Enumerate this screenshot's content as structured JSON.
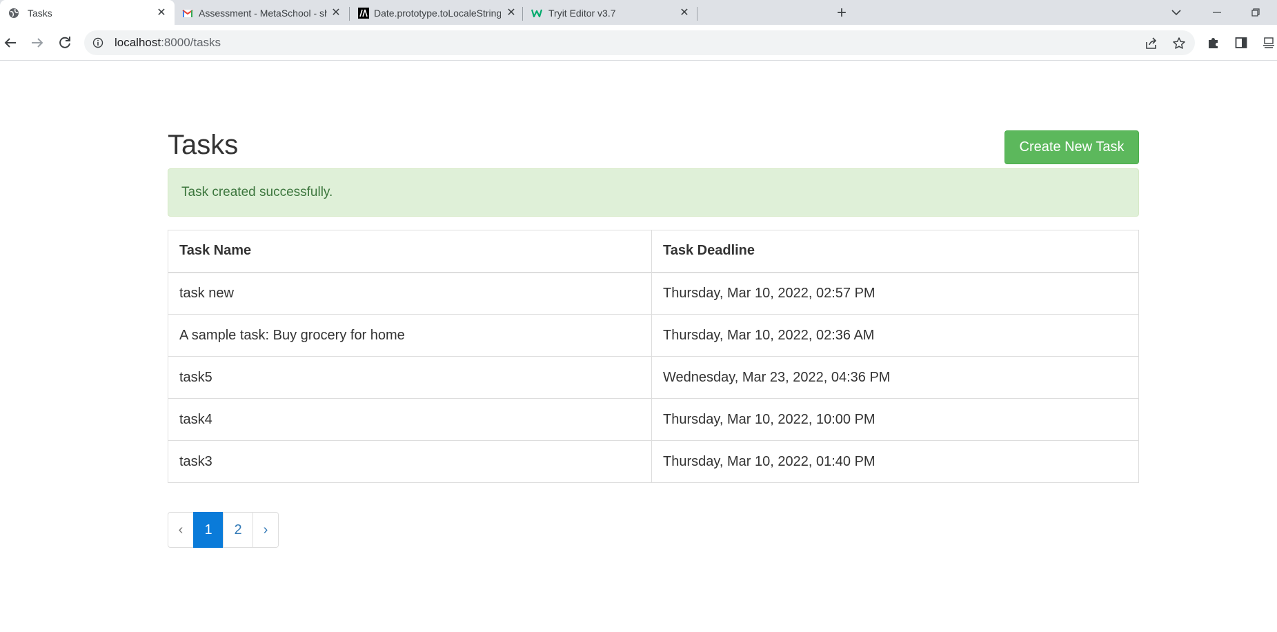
{
  "browser": {
    "tabs": [
      {
        "title": "Tasks",
        "icon": "globe-icon",
        "active": true
      },
      {
        "title": "Assessment - MetaSchool - shahi",
        "icon": "gmail-icon",
        "active": false
      },
      {
        "title": "Date.prototype.toLocaleString() -",
        "icon": "mdn-icon",
        "active": false
      },
      {
        "title": "Tryit Editor v3.7",
        "icon": "w3schools-icon",
        "active": false
      }
    ],
    "new_tab_label": "+",
    "address": {
      "host": "localhost",
      "path": ":8000/tasks"
    }
  },
  "page": {
    "title": "Tasks",
    "create_button_label": "Create New Task",
    "alert_message": "Task created successfully.",
    "table": {
      "headers": [
        "Task Name",
        "Task Deadline"
      ],
      "rows": [
        [
          "task new",
          "Thursday, Mar 10, 2022, 02:57 PM"
        ],
        [
          "A sample task: Buy grocery for home",
          "Thursday, Mar 10, 2022, 02:36 AM"
        ],
        [
          "task5",
          "Wednesday, Mar 23, 2022, 04:36 PM"
        ],
        [
          "task4",
          "Thursday, Mar 10, 2022, 10:00 PM"
        ],
        [
          "task3",
          "Thursday, Mar 10, 2022, 01:40 PM"
        ]
      ]
    },
    "pagination": {
      "prev": "‹",
      "pages": [
        "1",
        "2"
      ],
      "current": "1",
      "next": "›"
    }
  },
  "colors": {
    "success_button": "#5cb85c",
    "alert_bg": "#dff0d8",
    "alert_text": "#3c763d",
    "pagination_active": "#0a7bd9",
    "link": "#337ab7"
  }
}
